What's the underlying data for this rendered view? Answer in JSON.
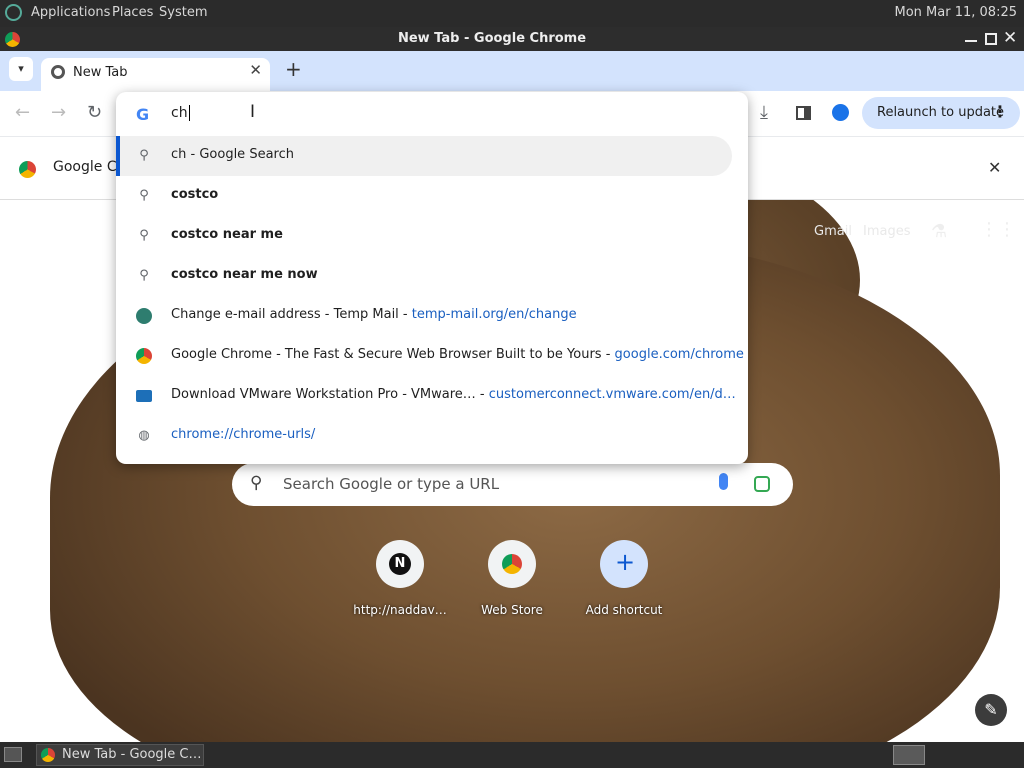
{
  "panel": {
    "menus": [
      "Applications",
      "Places",
      "System"
    ],
    "clock": "Mon Mar 11, 08:25"
  },
  "window": {
    "title": "New Tab - Google Chrome"
  },
  "tabs": {
    "active_label": "New Tab"
  },
  "toolbar": {
    "relaunch_label": "Relaunch to update"
  },
  "infobar": {
    "message": "Google Ch"
  },
  "omnibox": {
    "query": "ch",
    "suggestions": [
      {
        "icon": "search-icon",
        "text": "ch - Google Search",
        "url": ""
      },
      {
        "icon": "search-icon",
        "text": "costco",
        "url": ""
      },
      {
        "icon": "search-icon",
        "text": "costco near me",
        "url": ""
      },
      {
        "icon": "search-icon",
        "text": "costco near me now",
        "url": ""
      },
      {
        "icon": "tempmail-icon",
        "text": "Change e-mail address - Temp Mail",
        "url": "temp-mail.org/en/change"
      },
      {
        "icon": "chrome-icon",
        "text": "Google Chrome - The Fast & Secure Web Browser Built to be Yours",
        "url": "google.com/chrome"
      },
      {
        "icon": "vmware-icon",
        "text": "Download VMware Workstation Pro - VMware…",
        "url": "customerconnect.vmware.com/en/d…"
      },
      {
        "icon": "globe-icon",
        "text": "",
        "url": "chrome://chrome-urls/"
      }
    ]
  },
  "ntp": {
    "links": [
      "Gmail",
      "Images"
    ],
    "search_placeholder": "Search Google or type a URL",
    "shortcuts": [
      {
        "label": "http://naddav…",
        "glyph": "N"
      },
      {
        "label": "Web Store",
        "glyph": "◒"
      },
      {
        "label": "Add shortcut",
        "glyph": "+"
      }
    ]
  },
  "taskbar": {
    "task_label": "New Tab - Google C…"
  },
  "colors": {
    "accent": "#0b57d0",
    "tabstrip": "#d3e3fd",
    "url": "#1a5fc0"
  }
}
